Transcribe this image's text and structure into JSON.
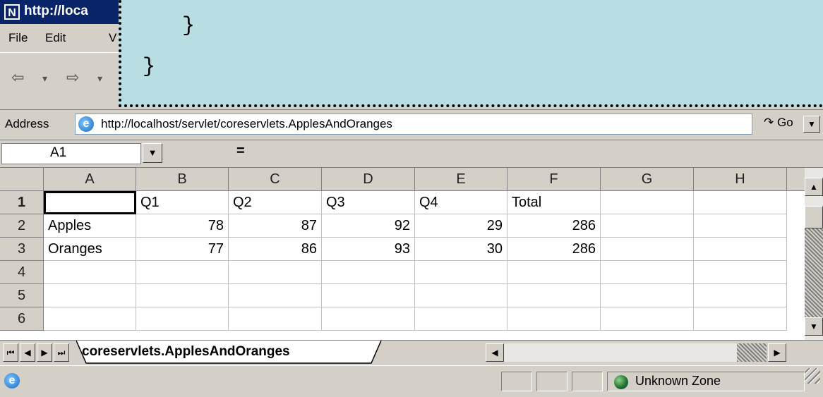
{
  "window": {
    "title": "http://loca"
  },
  "menu": {
    "items": [
      "File",
      "Edit",
      "V"
    ]
  },
  "toolbar": {
    "back_glyph": "⇦",
    "back_drop": "▾",
    "forward_glyph": "⇨",
    "forward_drop": "▾"
  },
  "address": {
    "label": "Address",
    "url": "http://localhost/servlet/coreservlets.ApplesAndOranges",
    "go_label": "Go"
  },
  "formula": {
    "name_box": "A1",
    "equals": "="
  },
  "sheet": {
    "column_headers": [
      "A",
      "B",
      "C",
      "D",
      "E",
      "F",
      "G",
      "H"
    ],
    "row_headers": [
      "1",
      "2",
      "3",
      "4",
      "5",
      "6"
    ],
    "rows": [
      [
        "",
        "Q1",
        "Q2",
        "Q3",
        "Q4",
        "Total",
        "",
        ""
      ],
      [
        "Apples",
        "78",
        "87",
        "92",
        "29",
        "286",
        "",
        ""
      ],
      [
        "Oranges",
        "77",
        "86",
        "93",
        "30",
        "286",
        "",
        ""
      ],
      [
        "",
        "",
        "",
        "",
        "",
        "",
        "",
        ""
      ],
      [
        "",
        "",
        "",
        "",
        "",
        "",
        "",
        ""
      ],
      [
        "",
        "",
        "",
        "",
        "",
        "",
        "",
        ""
      ]
    ],
    "tab_name": "coreservlets.ApplesAndOranges"
  },
  "status": {
    "zone": "Unknown Zone"
  },
  "code_overlay": {
    "lines": [
      "}",
      "}"
    ]
  },
  "colors": {
    "title_bar": "#0a246a",
    "chrome": "#d4d0c8",
    "overlay_bg": "#b8dde2"
  }
}
